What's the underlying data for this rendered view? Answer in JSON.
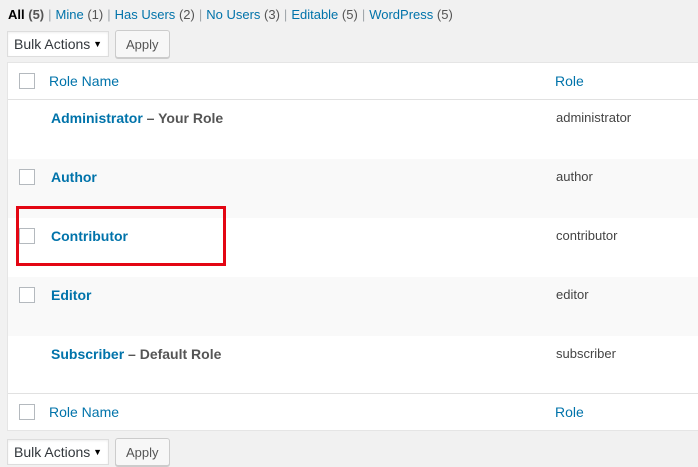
{
  "filters": [
    {
      "label": "All",
      "count": "(5)",
      "current": true
    },
    {
      "label": "Mine",
      "count": "(1)"
    },
    {
      "label": "Has Users",
      "count": "(2)"
    },
    {
      "label": "No Users",
      "count": "(3)"
    },
    {
      "label": "Editable",
      "count": "(5)"
    },
    {
      "label": "WordPress",
      "count": "(5)"
    }
  ],
  "bulk": {
    "select_label": "Bulk Actions",
    "apply_label": "Apply"
  },
  "table": {
    "col_name": "Role Name",
    "col_role": "Role",
    "rows": [
      {
        "name": "Administrator",
        "state": " – Your Role",
        "role": "administrator",
        "checkbox": false
      },
      {
        "name": "Author",
        "state": "",
        "role": "author",
        "checkbox": true
      },
      {
        "name": "Contributor",
        "state": "",
        "role": "contributor",
        "checkbox": true
      },
      {
        "name": "Editor",
        "state": "",
        "role": "editor",
        "checkbox": true
      },
      {
        "name": "Subscriber",
        "state": " – Default Role",
        "role": "subscriber",
        "checkbox": false
      }
    ]
  },
  "colors": {
    "link": "#0073aa",
    "highlight": "#e30613"
  }
}
